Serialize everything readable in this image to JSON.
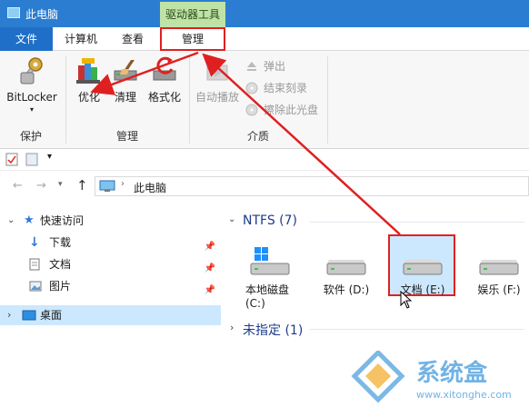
{
  "window": {
    "title": "此电脑",
    "context_tab": "驱动器工具"
  },
  "ribbon_tabs": {
    "file": "文件",
    "computer": "计算机",
    "view": "查看",
    "manage": "管理"
  },
  "ribbon": {
    "bitlocker": "BitLocker",
    "optimize": "优化",
    "cleanup": "清理",
    "format": "格式化",
    "autoplay": "自动播放",
    "eject": "弹出",
    "finish_burn": "结束刻录",
    "erase_disc": "擦除此光盘",
    "groups": {
      "protect": "保护",
      "manage": "管理",
      "media": "介质"
    }
  },
  "address": {
    "location": "此电脑"
  },
  "nav": {
    "quick_access": "快速访问",
    "downloads": "下载",
    "documents": "文档",
    "pictures": "图片",
    "desktop": "桌面"
  },
  "content": {
    "ntfs_group": "NTFS (7)",
    "unassigned_group": "未指定 (1)",
    "drives": [
      {
        "label": "本地磁盘\n(C:)"
      },
      {
        "label": "软件 (D:)"
      },
      {
        "label": "文档 (E:)"
      },
      {
        "label": "娱乐 (F:)"
      }
    ]
  },
  "watermark": {
    "brand": "系统盒",
    "url": "www.xitonghe.com"
  },
  "colors": {
    "title_bar": "#2b7dd2",
    "context_tab": "#bfe3a6",
    "highlight": "#e02020",
    "selection": "#cce8ff",
    "nav_selected": "#cce8ff"
  }
}
